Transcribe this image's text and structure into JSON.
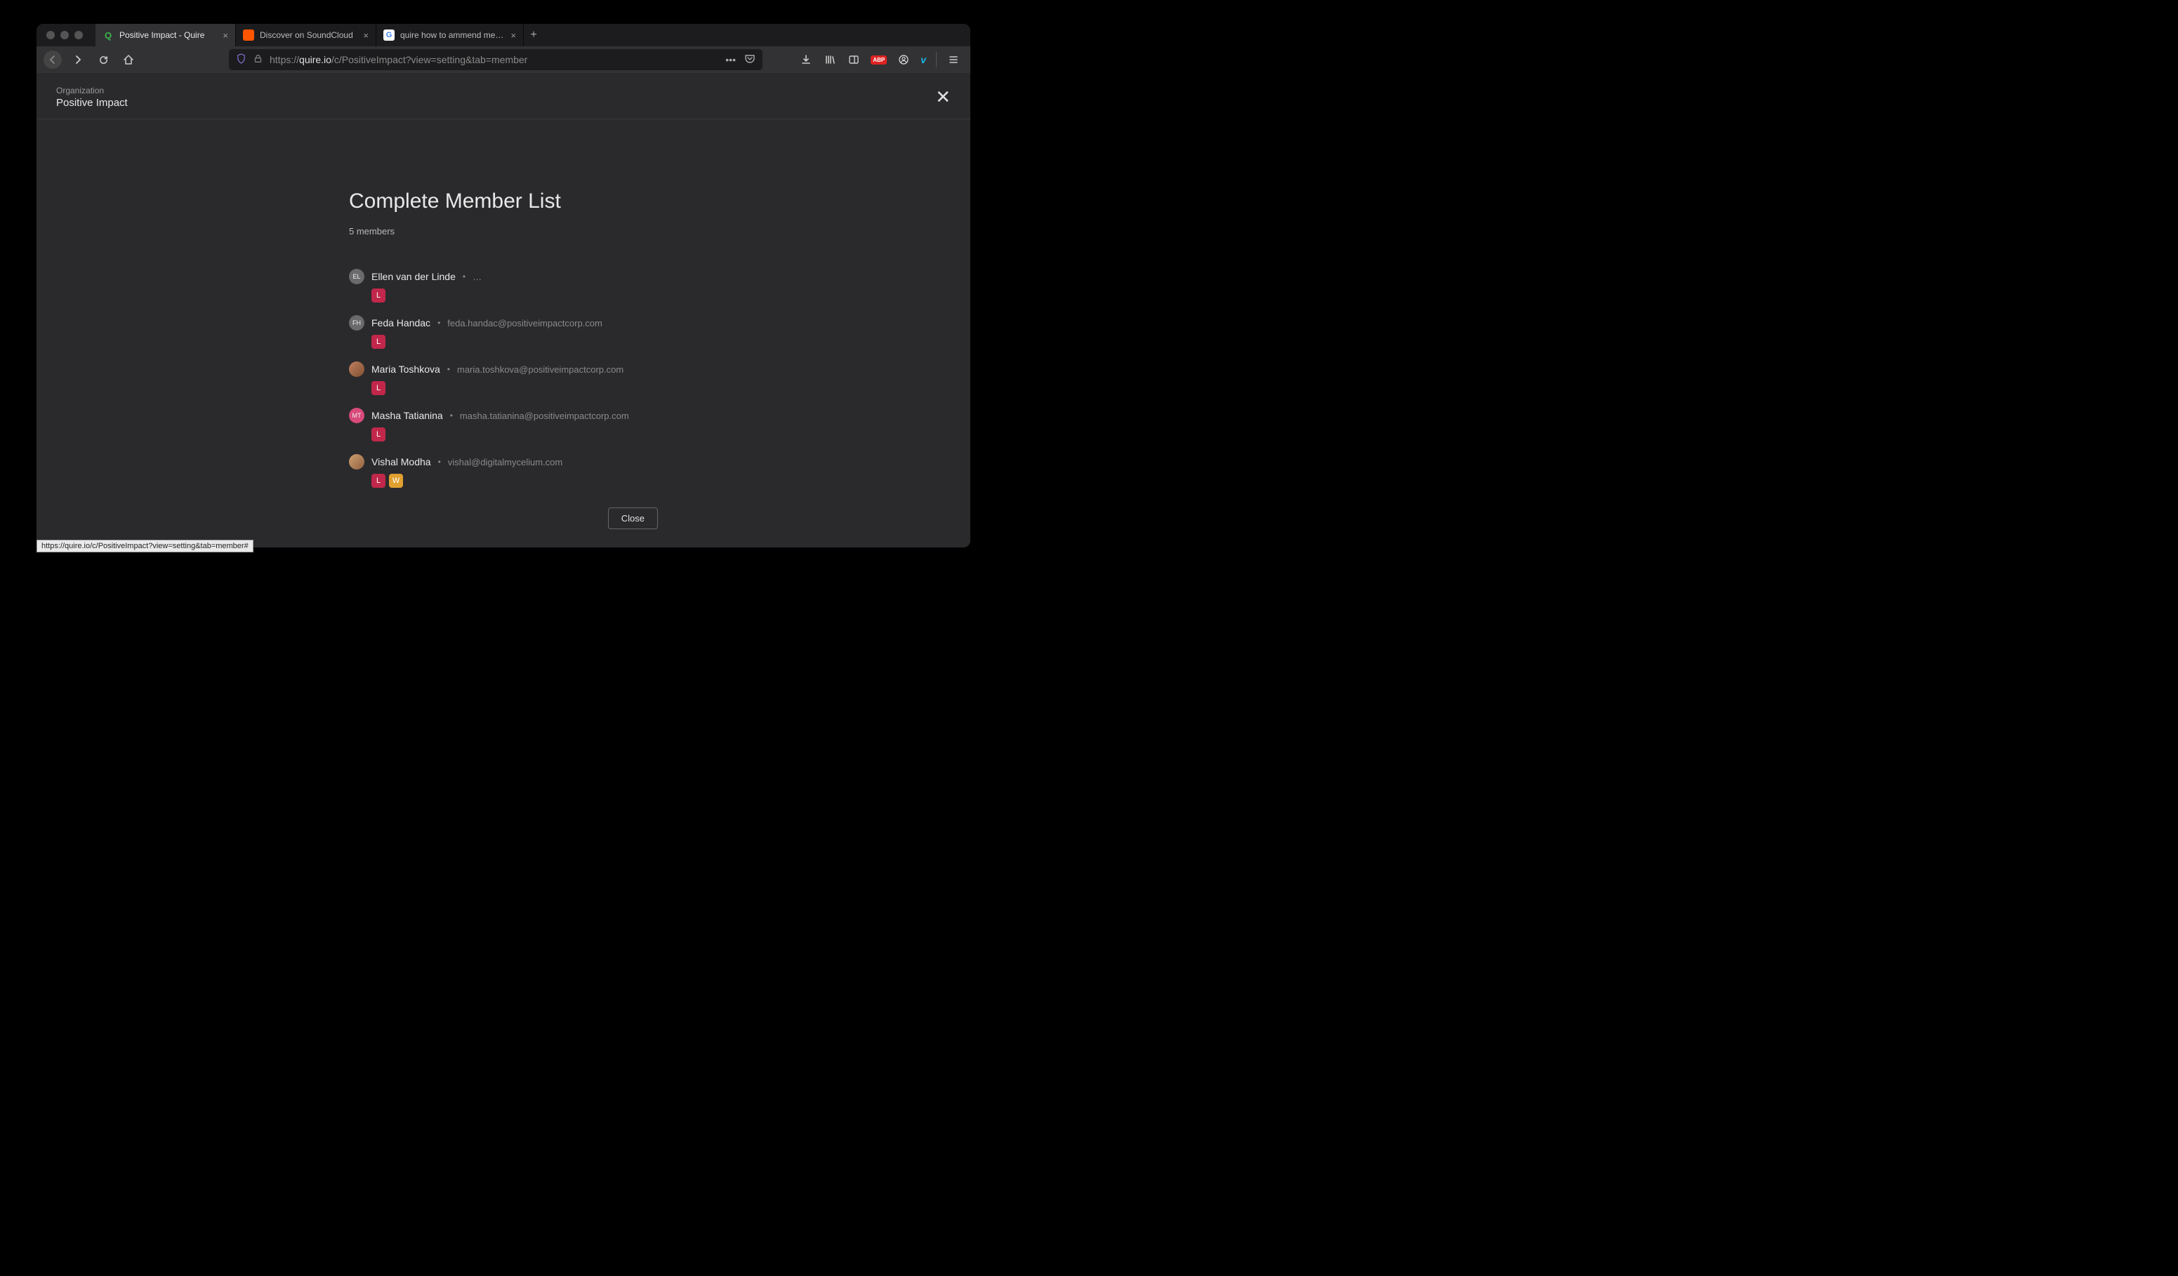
{
  "tabs": [
    {
      "title": "Positive Impact - Quire",
      "favicon_color": "#3ab54a",
      "favicon_letter": "Q",
      "active": true
    },
    {
      "title": "Discover on SoundCloud",
      "favicon_color": "#ff5500",
      "favicon_letter": "",
      "active": false
    },
    {
      "title": "quire how to ammend members",
      "favicon_color": "#ffffff",
      "favicon_letter": "G",
      "active": false
    }
  ],
  "url": {
    "scheme": "https://",
    "host": "quire.io",
    "path": "/c/PositiveImpact?view=setting&tab=member"
  },
  "header": {
    "org_label": "Organization",
    "org_name": "Positive Impact"
  },
  "panel": {
    "title": "Complete Member List",
    "count_label": "5 members",
    "close_label": "Close"
  },
  "members": [
    {
      "initials": "EL",
      "avatar_type": "initials",
      "name": "Ellen van der Linde",
      "email": "…",
      "badges": [
        "L"
      ]
    },
    {
      "initials": "FH",
      "avatar_type": "initials",
      "name": "Feda Handac",
      "email": "feda.handac@positiveimpactcorp.com",
      "badges": [
        "L"
      ]
    },
    {
      "initials": "",
      "avatar_type": "photo",
      "name": "Maria Toshkova",
      "email": "maria.toshkova@positiveimpactcorp.com",
      "badges": [
        "L"
      ]
    },
    {
      "initials": "MT",
      "avatar_type": "pink",
      "name": "Masha Tatianina",
      "email": "masha.tatianina@positiveimpactcorp.com",
      "badges": [
        "L"
      ]
    },
    {
      "initials": "",
      "avatar_type": "photo2",
      "name": "Vishal Modha",
      "email": "vishal@digitalmycelium.com",
      "badges": [
        "L",
        "W"
      ]
    }
  ],
  "status_tooltip": "https://quire.io/c/PositiveImpact?view=setting&tab=member#"
}
